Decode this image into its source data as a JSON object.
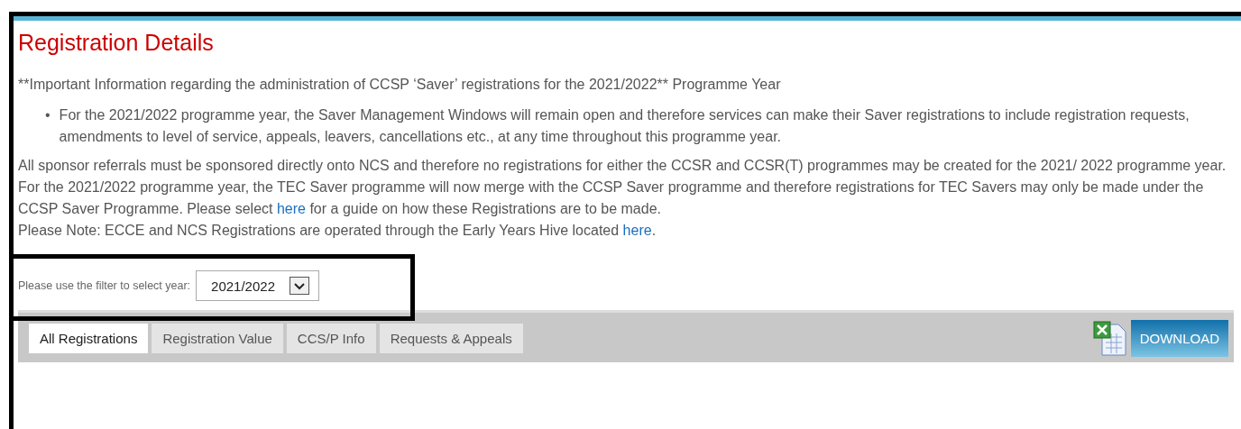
{
  "page": {
    "title": "Registration Details",
    "notice": "**Important Information regarding the administration of CCSP ‘Saver’ registrations for the 2021/2022** Programme Year",
    "bullets": [
      {
        "marker": "•",
        "text": "For the 2021/2022 programme year, the Saver Management Windows will remain open and therefore services can make their Saver registrations to include registration requests, amendments to level of service, appeals, leavers, cancellations etc., at any time throughout this programme year."
      }
    ],
    "paragraphs": [
      {
        "text": "All sponsor referrals must be sponsored directly onto NCS and therefore no registrations for either the CCSR and CCSR(T) programmes may be created for the 2021/ 2022 programme year."
      },
      {
        "text": "For the 2021/2022 programme year, the TEC Saver programme will now merge with the CCSP Saver programme and therefore registrations for TEC Savers may only be made under the CCSP Saver Programme. Please select ",
        "link": "here",
        "after": " for a guide on how these Registrations are to be made."
      },
      {
        "text": "Please Note: ECCE and NCS Registrations are operated through the Early Years Hive located ",
        "link": "here",
        "after": "."
      }
    ]
  },
  "filter": {
    "label": "Please use the filter to select year:",
    "value": "2021/2022"
  },
  "tabs": [
    {
      "label": "All Registrations",
      "selected": true
    },
    {
      "label": "Registration Value",
      "selected": false
    },
    {
      "label": "CCS/P Info",
      "selected": false
    },
    {
      "label": "Requests & Appeals",
      "selected": false
    }
  ],
  "download_button": "DOWNLOAD"
}
